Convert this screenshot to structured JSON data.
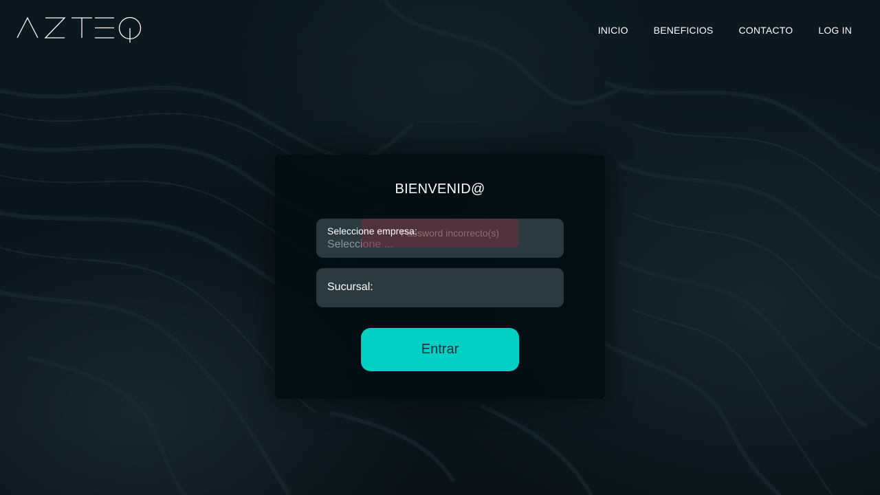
{
  "brand": {
    "logo_text": "AZTEQ"
  },
  "nav": {
    "items": [
      {
        "label": "INICIO"
      },
      {
        "label": "BENEFICIOS"
      },
      {
        "label": "CONTACTO"
      },
      {
        "label": "LOG IN"
      }
    ]
  },
  "login": {
    "title": "BIENVENID@",
    "company_label": "Seleccione empresa:",
    "company_value": "Seleccione ...",
    "branch_label": "Sucursal:",
    "error_message": "Password incorrecto(s)",
    "submit_label": "Entrar"
  },
  "colors": {
    "accent": "#00cfc4",
    "background": "#0a161d",
    "card": "#010e14",
    "field": "#2b3a41",
    "error": "#6e2c34"
  }
}
